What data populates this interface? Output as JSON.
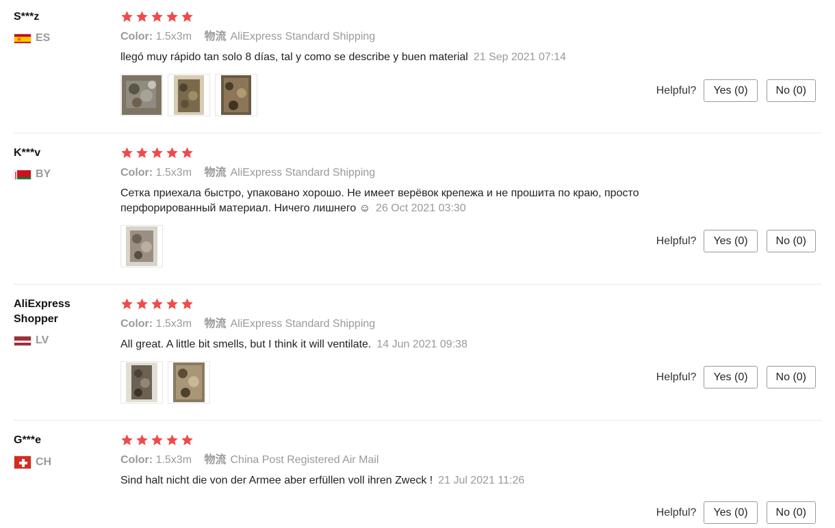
{
  "reviews": [
    {
      "user": "S***z",
      "country_code": "ES",
      "rating": 5,
      "color_label": "Color:",
      "color_value": "1.5x3m",
      "shipping_label": "物流",
      "shipping_value": "AliExpress Standard Shipping",
      "text": "llegó muy rápido tan solo 8 días, tal y como se describe y buen material",
      "date": "21 Sep 2021 07:14",
      "helpful_label": "Helpful?",
      "yes_label": "Yes (0)",
      "no_label": "No (0)"
    },
    {
      "user": "K***v",
      "country_code": "BY",
      "rating": 5,
      "color_label": "Color:",
      "color_value": "1.5x3m",
      "shipping_label": "物流",
      "shipping_value": "AliExpress Standard Shipping",
      "text": "Сетка приехала быстро, упаковано хорошо. Не имеет верёвок крепежа и не прошита по краю, просто перфорированный материал. Ничего лишнего ☺",
      "date": "26 Oct 2021 03:30",
      "helpful_label": "Helpful?",
      "yes_label": "Yes (0)",
      "no_label": "No (0)"
    },
    {
      "user": "AliExpress Shopper",
      "country_code": "LV",
      "rating": 5,
      "color_label": "Color:",
      "color_value": "1.5x3m",
      "shipping_label": "物流",
      "shipping_value": "AliExpress Standard Shipping",
      "text": "All great. A little bit smells, but I think it will ventilate.",
      "date": "14 Jun 2021 09:38",
      "helpful_label": "Helpful?",
      "yes_label": "Yes (0)",
      "no_label": "No (0)"
    },
    {
      "user": "G***e",
      "country_code": "CH",
      "rating": 5,
      "color_label": "Color:",
      "color_value": "1.5x3m",
      "shipping_label": "物流",
      "shipping_value": "China Post Registered Air Mail",
      "text": "Sind halt nicht die von der Armee aber erfüllen voll ihren Zweck !",
      "date": "21 Jul 2021 11:26",
      "helpful_label": "Helpful?",
      "yes_label": "Yes (0)",
      "no_label": "No (0)"
    }
  ],
  "colors": {
    "star": "#f04a4a",
    "muted": "#999999",
    "divider": "#e8e8e8",
    "button_border": "#999999"
  },
  "icons": {
    "star": "star-icon",
    "flags": [
      "spain-flag-icon",
      "belarus-flag-icon",
      "latvia-flag-icon",
      "switzerland-flag-icon"
    ],
    "photo": "review-photo"
  }
}
